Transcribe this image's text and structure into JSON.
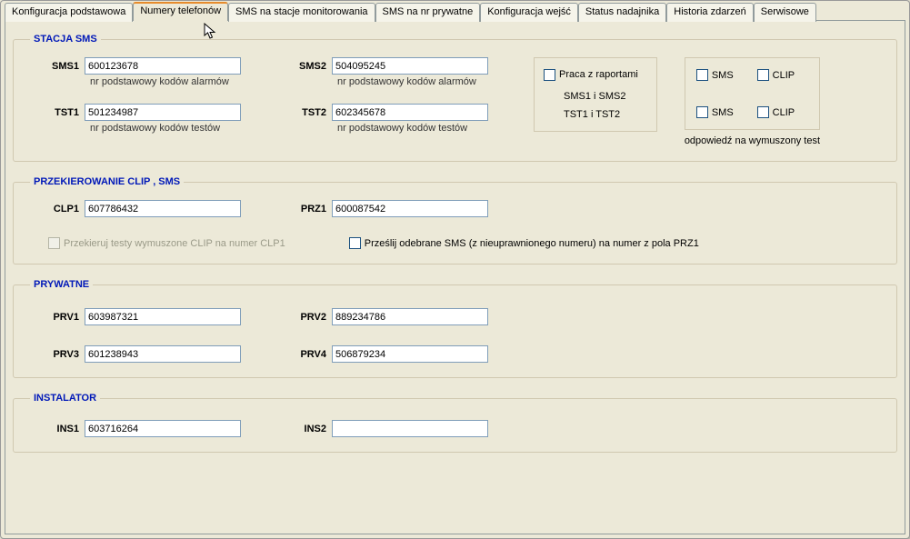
{
  "tabs": [
    {
      "label": "Konfiguracja podstawowa"
    },
    {
      "label": "Numery telefonów"
    },
    {
      "label": "SMS na stacje monitorowania"
    },
    {
      "label": "SMS na nr prywatne"
    },
    {
      "label": "Konfiguracja wejść"
    },
    {
      "label": "Status nadajnika"
    },
    {
      "label": "Historia zdarzeń"
    },
    {
      "label": "Serwisowe"
    }
  ],
  "stacja": {
    "legend": "STACJA SMS",
    "sms1_label": "SMS1",
    "sms1_value": "600123678",
    "sms1_hint": "nr podstawowy kodów alarmów",
    "sms2_label": "SMS2",
    "sms2_value": "504095245",
    "sms2_hint": "nr podstawowy kodów alarmów",
    "tst1_label": "TST1",
    "tst1_value": "501234987",
    "tst1_hint": "nr podstawowy kodów testów",
    "tst2_label": "TST2",
    "tst2_value": "602345678",
    "tst2_hint": "nr podstawowy kodów testów",
    "reports_cb": "Praca z raportami",
    "reports_l1": "SMS1 i SMS2",
    "reports_l2": "TST1 i TST2",
    "sms_cb": "SMS",
    "clip_cb": "CLIP",
    "resp_label": "odpowiedź na  wymuszony test"
  },
  "przek": {
    "legend": "PRZEKIEROWANIE CLIP , SMS",
    "clp1_label": "CLP1",
    "clp1_value": "607786432",
    "prz1_label": "PRZ1",
    "prz1_value": "600087542",
    "cb1": "Przekieruj testy wymuszone CLIP  na numer CLP1",
    "cb2": "Prześlij odebrane SMS (z nieuprawnionego numeru) na numer z pola PRZ1"
  },
  "pryw": {
    "legend": "PRYWATNE",
    "prv1_label": "PRV1",
    "prv1_value": "603987321",
    "prv2_label": "PRV2",
    "prv2_value": "889234786",
    "prv3_label": "PRV3",
    "prv3_value": "601238943",
    "prv4_label": "PRV4",
    "prv4_value": "506879234"
  },
  "inst": {
    "legend": "INSTALATOR",
    "ins1_label": "INS1",
    "ins1_value": "603716264",
    "ins2_label": "INS2",
    "ins2_value": ""
  }
}
